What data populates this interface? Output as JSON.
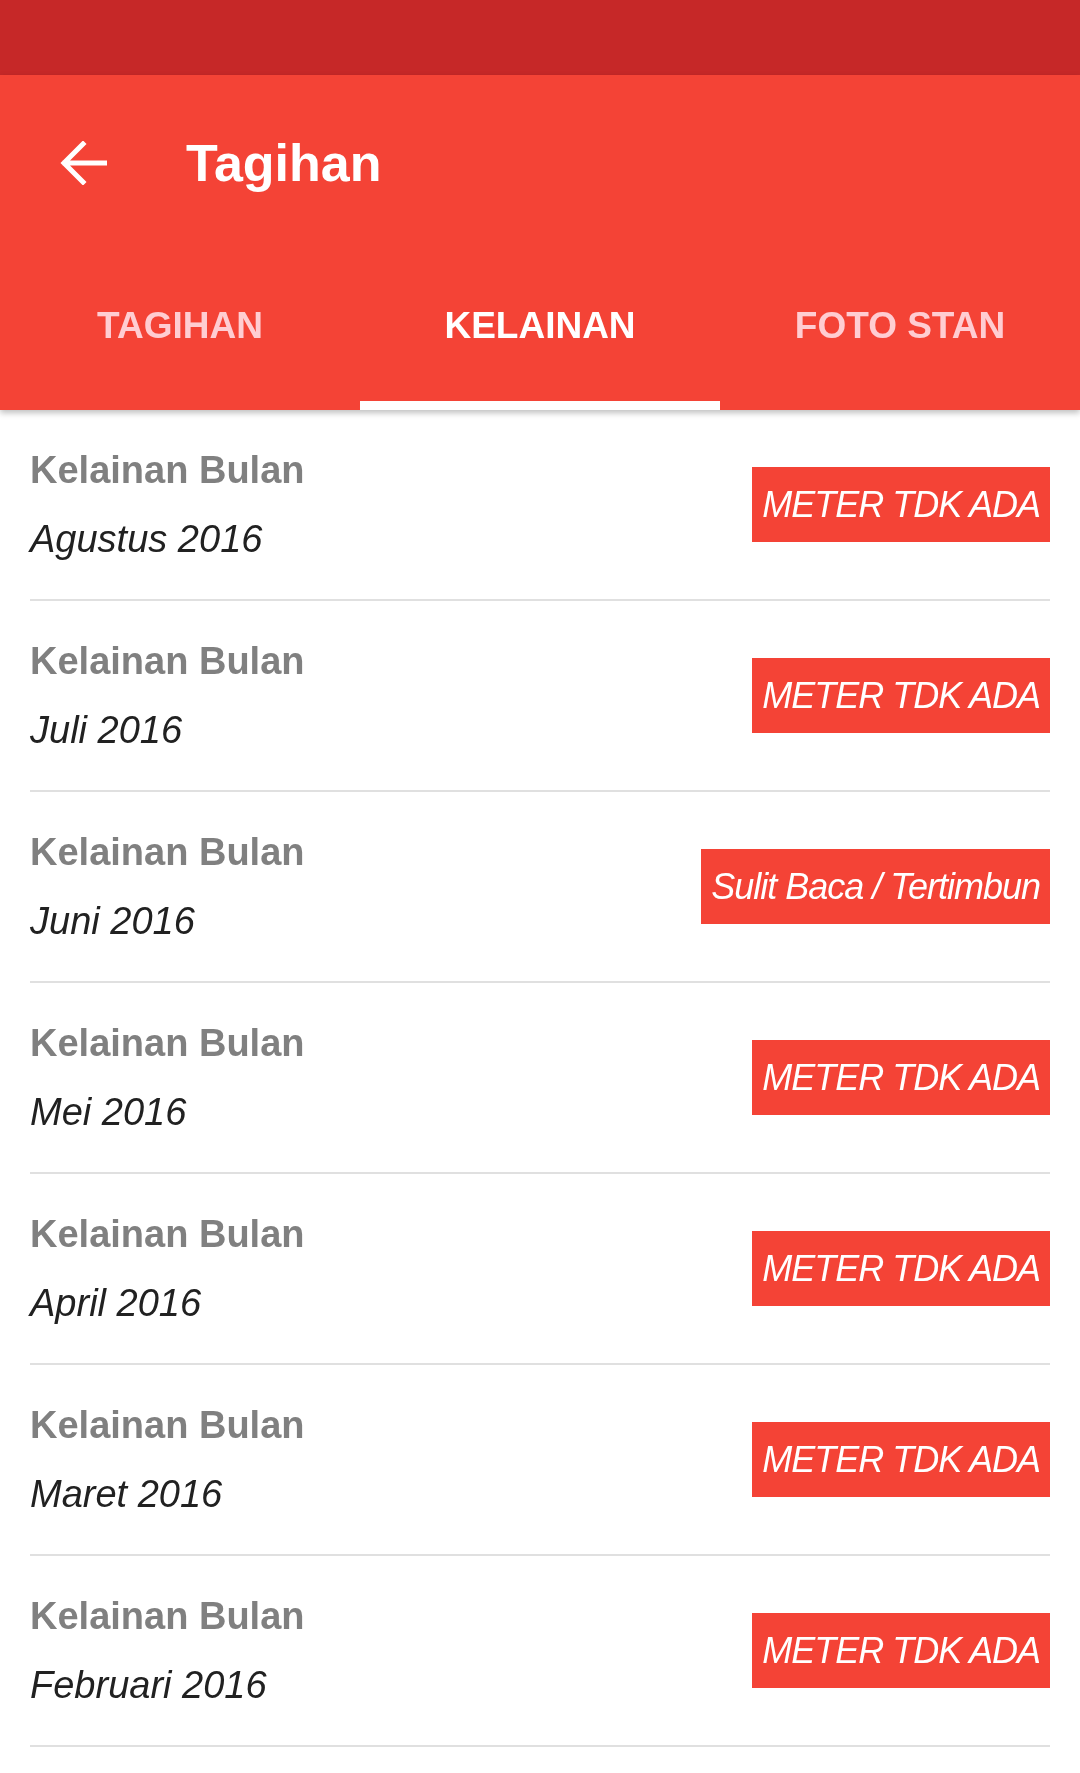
{
  "app_bar": {
    "title": "Tagihan"
  },
  "tabs": [
    {
      "label": "TAGIHAN",
      "selected": false
    },
    {
      "label": "KELAINAN",
      "selected": true
    },
    {
      "label": "FOTO STAN",
      "selected": false
    }
  ],
  "rows": [
    {
      "label": "Kelainan Bulan",
      "month": "Agustus 2016",
      "badge": "METER TDK ADA"
    },
    {
      "label": "Kelainan Bulan",
      "month": "Juli 2016",
      "badge": "METER TDK ADA"
    },
    {
      "label": "Kelainan Bulan",
      "month": "Juni 2016",
      "badge": "Sulit Baca / Tertimbun"
    },
    {
      "label": "Kelainan Bulan",
      "month": "Mei 2016",
      "badge": "METER TDK ADA"
    },
    {
      "label": "Kelainan Bulan",
      "month": "April 2016",
      "badge": "METER TDK ADA"
    },
    {
      "label": "Kelainan Bulan",
      "month": "Maret 2016",
      "badge": "METER TDK ADA"
    },
    {
      "label": "Kelainan Bulan",
      "month": "Februari 2016",
      "badge": "METER TDK ADA"
    }
  ]
}
